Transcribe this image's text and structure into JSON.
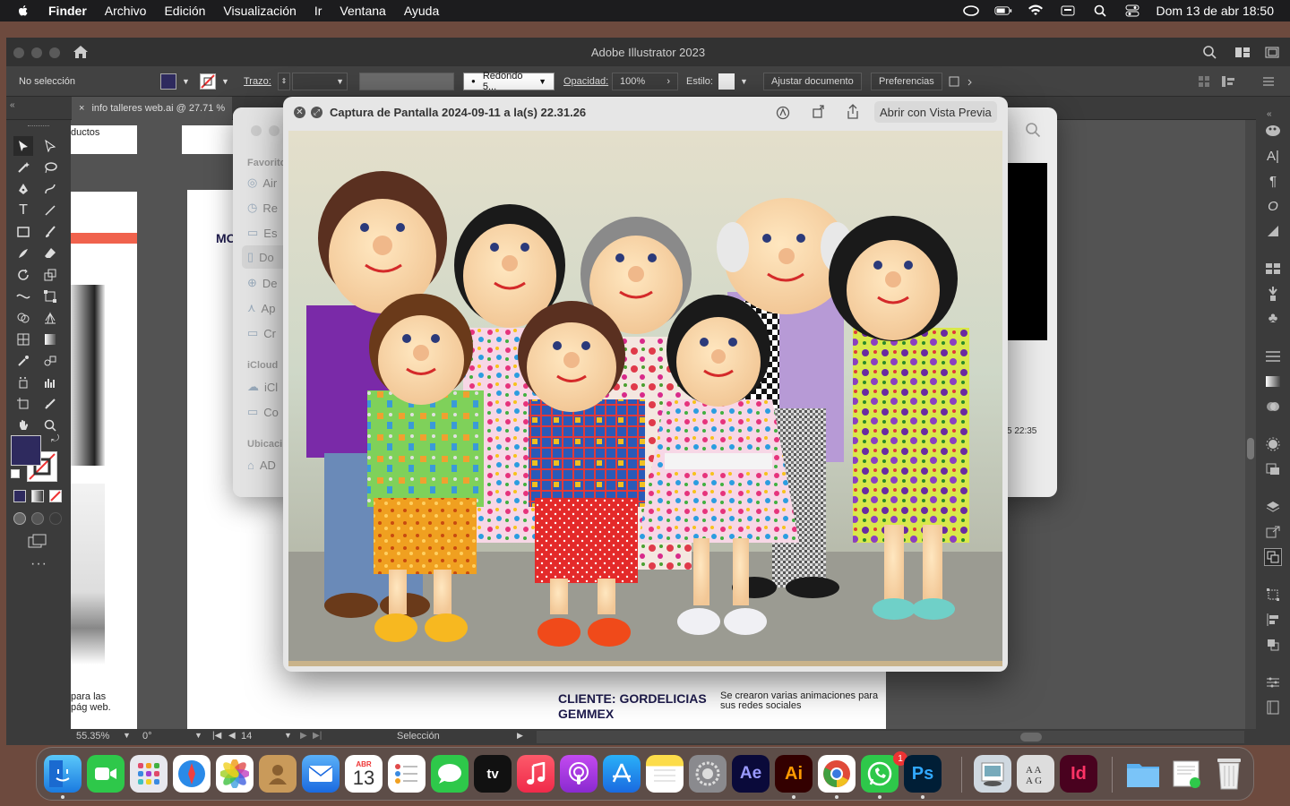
{
  "menubar": {
    "items": [
      "Finder",
      "Archivo",
      "Edición",
      "Visualización",
      "Ir",
      "Ventana",
      "Ayuda"
    ],
    "datetime": "Dom 13 de abr  18:50"
  },
  "illustrator": {
    "title": "Adobe Illustrator 2023",
    "control": {
      "selection": "No selección",
      "stroke_label": "Trazo:",
      "brush": "Redondo 5...",
      "opacity_label": "Opacidad:",
      "opacity_value": "100%",
      "style_label": "Estilo:",
      "fit_button": "Ajustar documento",
      "prefs_button": "Preferencias"
    },
    "tab": {
      "close": "×",
      "label": "info talleres web.ai @ 27.71 %"
    },
    "status": {
      "zoom": "55.35%",
      "rotation": "0°",
      "artboard": "14",
      "tool": "Selección"
    },
    "canvas": {
      "text_products": "ductos",
      "text_mo": "MO",
      "text_client": "CLIENTE: GORDELICIAS GEMMEX",
      "text_client_desc": "Se crearon varias animaciones para sus redes sociales",
      "text_web_1": "para las",
      "text_web_2": "pág web.",
      "finder_time": "5  22:35"
    },
    "colors": {
      "fill": "#2e2a5e",
      "accent_red": "#f0624d",
      "navy": "#1e1b4d"
    }
  },
  "finder": {
    "favorites_label": "Favorito",
    "items": [
      "Air",
      "Re",
      "Es",
      "Do",
      "De",
      "Ap",
      "Cr"
    ],
    "icloud_label": "iCloud",
    "icloud_items": [
      "iCl",
      "Co"
    ],
    "locations_label": "Ubicaci",
    "locations_items": [
      "AD"
    ]
  },
  "quicklook": {
    "title": "Captura de Pantalla 2024-09-11 a la(s) 22.31.26",
    "open_button": "Abrir con Vista Previa"
  },
  "dock": {
    "calendar_month": "ABR",
    "calendar_day": "13",
    "whatsapp_badge": "1",
    "ae_label": "Ae",
    "ai_label": "Ai",
    "ps_label": "Ps",
    "id_label": "Id"
  }
}
